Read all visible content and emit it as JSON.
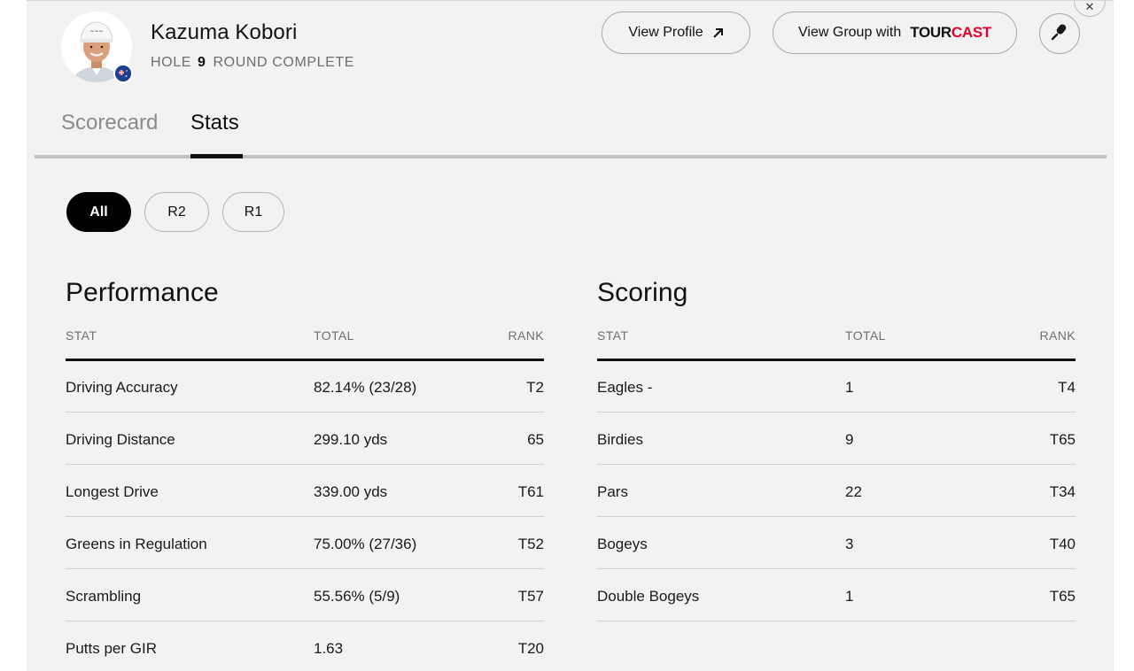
{
  "player": {
    "name": "Kazuma Kobori",
    "hole_label": "HOLE",
    "hole_number": "9",
    "round_status": "ROUND COMPLETE"
  },
  "header": {
    "view_profile_label": "View Profile",
    "view_group_label": "View Group with",
    "tourcast_tour": "TOUR",
    "tourcast_cast": "CAST"
  },
  "tabs": [
    {
      "label": "Scorecard",
      "active": false
    },
    {
      "label": "Stats",
      "active": true
    }
  ],
  "round_filters": [
    {
      "label": "All",
      "selected": true
    },
    {
      "label": "R2",
      "selected": false
    },
    {
      "label": "R1",
      "selected": false
    }
  ],
  "performance": {
    "title": "Performance",
    "columns": {
      "stat": "STAT",
      "total": "TOTAL",
      "rank": "RANK"
    },
    "rows": [
      {
        "stat": "Driving Accuracy",
        "total": "82.14% (23/28)",
        "rank": "T2"
      },
      {
        "stat": "Driving Distance",
        "total": "299.10 yds",
        "rank": "65"
      },
      {
        "stat": "Longest Drive",
        "total": "339.00 yds",
        "rank": "T61"
      },
      {
        "stat": "Greens in Regulation",
        "total": "75.00% (27/36)",
        "rank": "T52"
      },
      {
        "stat": "Scrambling",
        "total": "55.56% (5/9)",
        "rank": "T57"
      },
      {
        "stat": "Putts per GIR",
        "total": "1.63",
        "rank": "T20"
      }
    ]
  },
  "scoring": {
    "title": "Scoring",
    "columns": {
      "stat": "STAT",
      "total": "TOTAL",
      "rank": "RANK"
    },
    "rows": [
      {
        "stat": "Eagles -",
        "total": "1",
        "rank": "T4"
      },
      {
        "stat": "Birdies",
        "total": "9",
        "rank": "T65"
      },
      {
        "stat": "Pars",
        "total": "22",
        "rank": "T34"
      },
      {
        "stat": "Bogeys",
        "total": "3",
        "rank": "T40"
      },
      {
        "stat": "Double Bogeys",
        "total": "1",
        "rank": "T65"
      }
    ]
  },
  "colors": {
    "panel_bg": "#f2f2f2",
    "tourcast_red": "#e4002b",
    "active_pill": "#000000"
  },
  "icons": {
    "close": "close-icon",
    "external_link": "arrow-up-right-icon",
    "microphone": "microphone-icon",
    "flag": "country-flag-icon"
  }
}
